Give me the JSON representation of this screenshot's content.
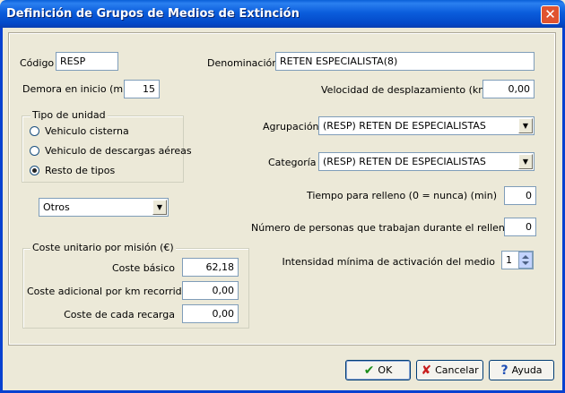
{
  "window": {
    "title": "Definición de Grupos de Medios de Extinción",
    "close": "✕"
  },
  "form": {
    "codigo": {
      "label": "Código",
      "value": "RESP"
    },
    "denominacion": {
      "label": "Denominación",
      "value": "RETEN ESPECIALISTA(8)"
    },
    "demora": {
      "label": "Demora en inicio (min)",
      "value": "15"
    },
    "velocidad": {
      "label": "Velocidad de desplazamiento (km/h)",
      "value": "0,00"
    },
    "tipo_unidad": {
      "legend": "Tipo de unidad",
      "options": [
        "Vehiculo cisterna",
        "Vehiculo de descargas aéreas",
        "Resto de tipos"
      ],
      "selected": "Resto de tipos"
    },
    "otros": {
      "value": "Otros"
    },
    "agrupacion": {
      "label": "Agrupación",
      "value": "(RESP) RETEN DE ESPECIALISTAS"
    },
    "categoria": {
      "label": "Categoría",
      "value": "(RESP) RETEN DE ESPECIALISTAS"
    },
    "tiempo_relleno": {
      "label": "Tiempo para relleno (0 = nunca) (min)",
      "value": "0"
    },
    "personas_relleno": {
      "label": "Número de personas que trabajan durante el relleno",
      "value": "0"
    },
    "intensidad": {
      "label": "Intensidad mínima de activación del medio",
      "value": "1"
    },
    "coste": {
      "legend": "Coste unitario por misión (€)",
      "basico": {
        "label": "Coste básico",
        "value": "62,18"
      },
      "km": {
        "label": "Coste adicional por km recorrido",
        "value": "0,00"
      },
      "recarga": {
        "label": "Coste de cada recarga",
        "value": "0,00"
      }
    }
  },
  "buttons": {
    "ok": "OK",
    "cancel": "Cancelar",
    "help": "Ayuda"
  },
  "icons": {
    "ok": "check-icon",
    "cancel": "x-icon",
    "help": "question-icon"
  }
}
